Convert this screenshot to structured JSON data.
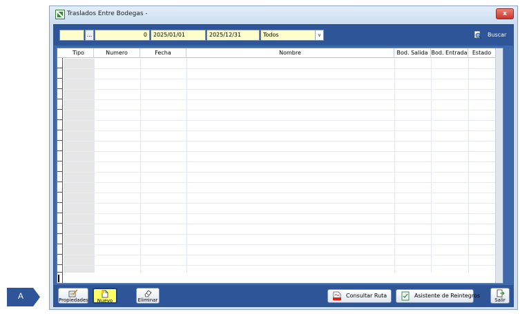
{
  "window": {
    "title": "Traslados Entre Bodegas -",
    "close_label": "x"
  },
  "filters": {
    "code_value": "",
    "lookup_label": "...",
    "number_value": "0",
    "date_from": "2025/01/01",
    "date_to": "2025/12/31",
    "status_selected": "Todos",
    "search_label": "Buscar"
  },
  "grid": {
    "columns": [
      "Tipo",
      "Numero",
      "Fecha",
      "Nombre",
      "Bod. Salida",
      "Bod. Entrada",
      "Estado"
    ],
    "rows": []
  },
  "toolbar": {
    "properties_label": "Propiedades",
    "new_label": "Nuevo",
    "delete_label": "Eliminar",
    "route_label": "Consultar Ruta",
    "refunds_label": "Asistente de Reintegros",
    "exit_label": "Salir"
  },
  "callout": {
    "label": "A"
  },
  "colors": {
    "client_bg": "#3e6aab",
    "bar_bg": "#2e5597",
    "field_bg": "#ffffcc",
    "accent_callout": "#2e5597"
  },
  "icons": {
    "app": "excel-sheet-icon",
    "search": "binoculars-search-icon",
    "properties": "notepad-pencil-icon",
    "new": "new-document-icon",
    "delete": "eraser-icon",
    "route": "pdf-route-icon",
    "refunds": "checklist-icon",
    "exit": "door-exit-icon"
  }
}
